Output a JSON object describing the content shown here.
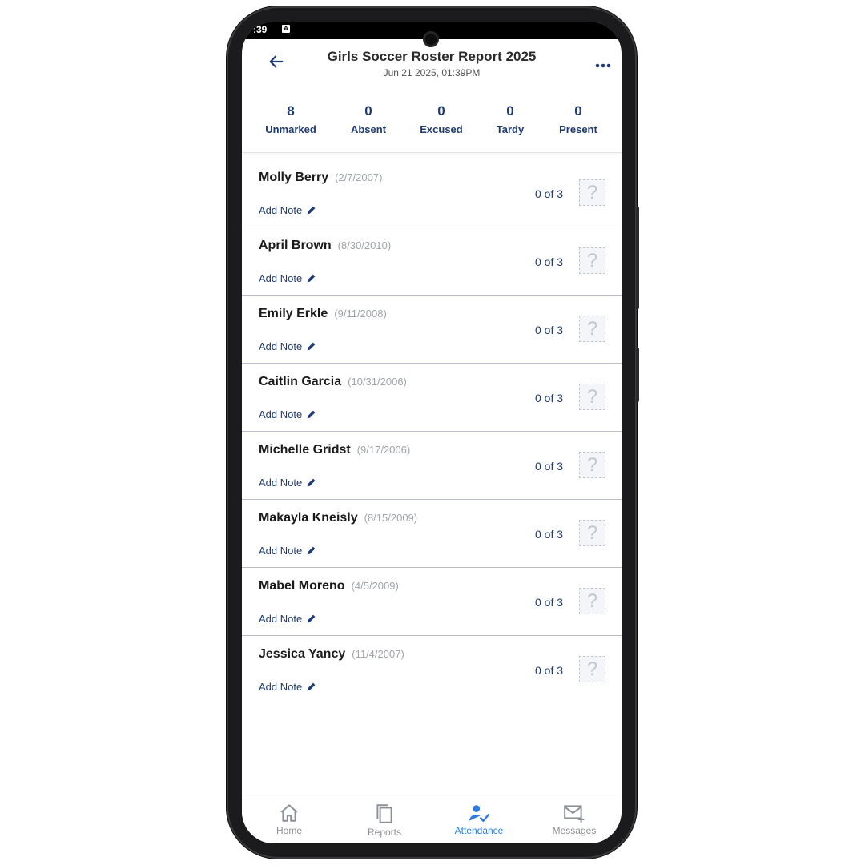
{
  "status_bar": {
    "time": ":39",
    "notification_icon": "A"
  },
  "header": {
    "title": "Girls Soccer Roster Report 2025",
    "subtitle": "Jun 21 2025, 01:39PM"
  },
  "stats": [
    {
      "value": "8",
      "label": "Unmarked"
    },
    {
      "value": "0",
      "label": "Absent"
    },
    {
      "value": "0",
      "label": "Excused"
    },
    {
      "value": "0",
      "label": "Tardy"
    },
    {
      "value": "0",
      "label": "Present"
    }
  ],
  "roster": [
    {
      "name": "Molly Berry",
      "dob": "(2/7/2007)",
      "note_label": "Add Note",
      "count": "0 of 3",
      "status": "?"
    },
    {
      "name": "April Brown",
      "dob": "(8/30/2010)",
      "note_label": "Add Note",
      "count": "0 of 3",
      "status": "?"
    },
    {
      "name": "Emily Erkle",
      "dob": "(9/11/2008)",
      "note_label": "Add Note",
      "count": "0 of 3",
      "status": "?"
    },
    {
      "name": "Caitlin Garcia",
      "dob": "(10/31/2006)",
      "note_label": "Add Note",
      "count": "0 of 3",
      "status": "?"
    },
    {
      "name": "Michelle Gridst",
      "dob": "(9/17/2006)",
      "note_label": "Add Note",
      "count": "0 of 3",
      "status": "?"
    },
    {
      "name": "Makayla Kneisly",
      "dob": "(8/15/2009)",
      "note_label": "Add Note",
      "count": "0 of 3",
      "status": "?"
    },
    {
      "name": "Mabel Moreno",
      "dob": "(4/5/2009)",
      "note_label": "Add Note",
      "count": "0 of 3",
      "status": "?"
    },
    {
      "name": "Jessica Yancy",
      "dob": "(11/4/2007)",
      "note_label": "Add Note",
      "count": "0 of 3",
      "status": "?"
    }
  ],
  "nav": [
    {
      "label": "Home",
      "icon": "home-icon"
    },
    {
      "label": "Reports",
      "icon": "copy-icon"
    },
    {
      "label": "Attendance",
      "icon": "user-check-icon",
      "active": true
    },
    {
      "label": "Messages",
      "icon": "mail-plus-icon"
    }
  ],
  "colors": {
    "primary": "#1e3b73",
    "accent": "#2c7be5",
    "divider": "#b9bccb"
  }
}
